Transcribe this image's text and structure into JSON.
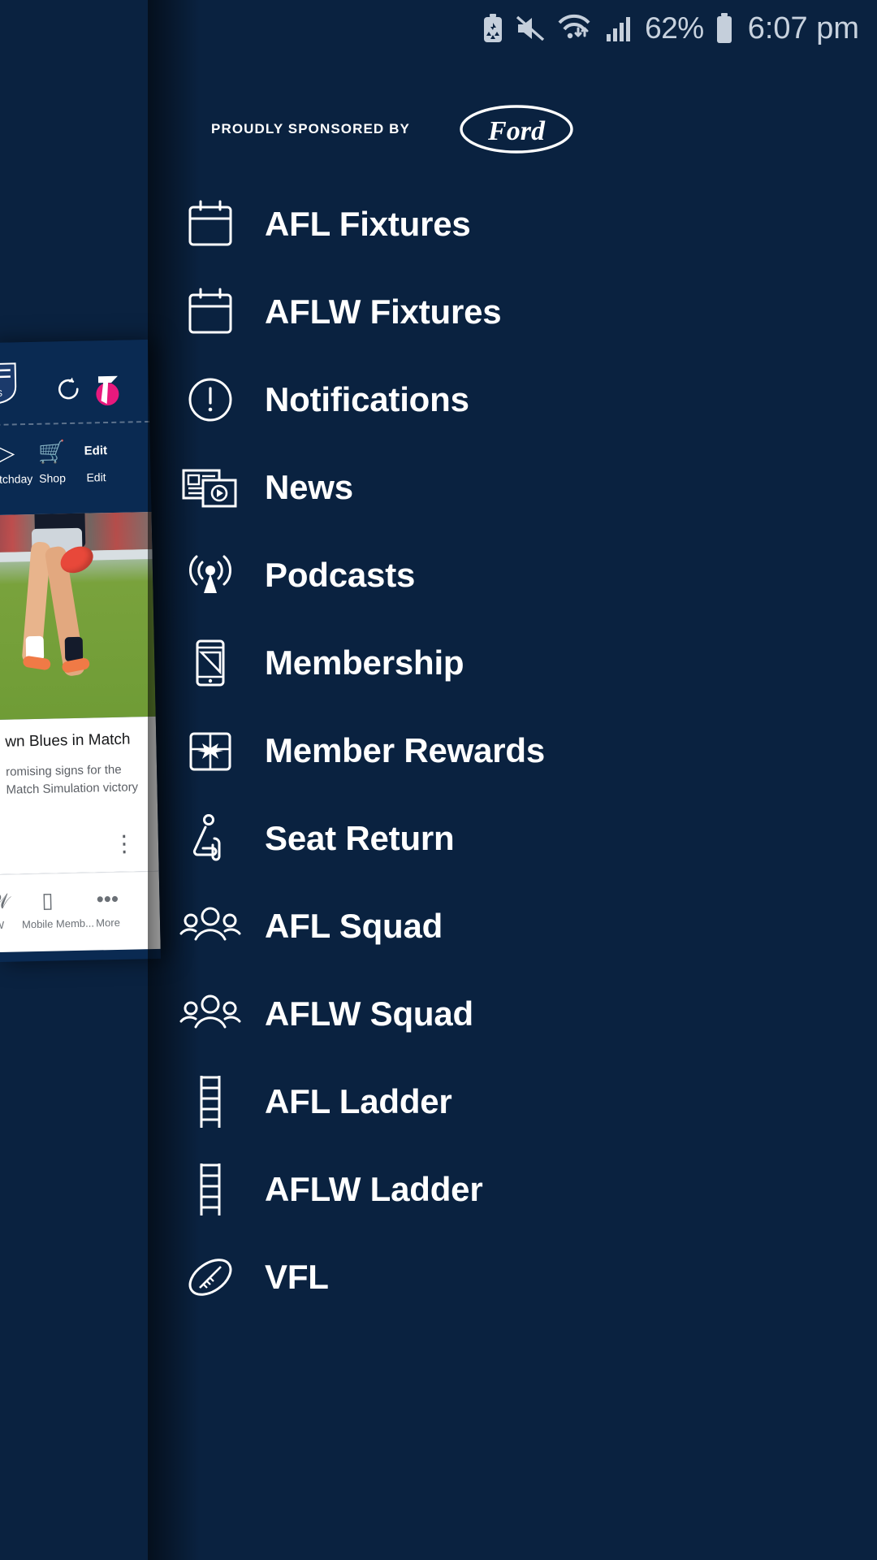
{
  "status_bar": {
    "icons": [
      "battery-saver-icon",
      "mute-icon",
      "wifi-icon",
      "signal-icon"
    ],
    "battery_percent": "62%",
    "battery_icon": "battery-icon",
    "time": "6:07 pm"
  },
  "drawer": {
    "sponsor_label": "PROUDLY SPONSORED BY",
    "sponsor_brand": "Ford",
    "items": [
      {
        "label": "AFL Fixtures",
        "icon": "calendar-icon"
      },
      {
        "label": "AFLW Fixtures",
        "icon": "calendar-icon"
      },
      {
        "label": "Notifications",
        "icon": "alert-circle-icon"
      },
      {
        "label": "News",
        "icon": "newspaper-video-icon"
      },
      {
        "label": "Podcasts",
        "icon": "broadcast-icon"
      },
      {
        "label": "Membership",
        "icon": "mobile-ticket-icon"
      },
      {
        "label": "Member Rewards",
        "icon": "gift-icon"
      },
      {
        "label": "Seat Return",
        "icon": "seat-icon"
      },
      {
        "label": "AFL Squad",
        "icon": "people-group-icon"
      },
      {
        "label": "AFLW Squad",
        "icon": "people-group-icon"
      },
      {
        "label": "AFL Ladder",
        "icon": "ladder-icon"
      },
      {
        "label": "AFLW Ladder",
        "icon": "ladder-icon"
      },
      {
        "label": "VFL",
        "icon": "football-icon"
      }
    ]
  },
  "background_app": {
    "crest": "club-crest-icon",
    "refresh_icon": "refresh-icon",
    "sponsor_logo": "telstra-logo",
    "quick_actions": [
      {
        "label": "Matchday",
        "icon": "play-icon"
      },
      {
        "label": "Shop",
        "icon": "cart-icon"
      },
      {
        "label": "Edit",
        "icon": "edit-label"
      }
    ],
    "edit_button": "Edit",
    "article": {
      "headline": "wn Blues in Match",
      "summary": "romising signs for the\nMatch Simulation victory",
      "more_icon": "kebab-menu-icon"
    },
    "bottom_nav": [
      {
        "label": "W",
        "icon": "aflw-icon"
      },
      {
        "label": "Mobile Memb...",
        "icon": "mobile-member-icon"
      },
      {
        "label": "More",
        "icon": "more-dots-icon"
      }
    ]
  },
  "colors": {
    "background": "#0a2240",
    "drawer_text": "#ffffff",
    "status_text": "#c8d2de",
    "card_background": "#ffffff",
    "telstra_pink": "#e8197d"
  }
}
